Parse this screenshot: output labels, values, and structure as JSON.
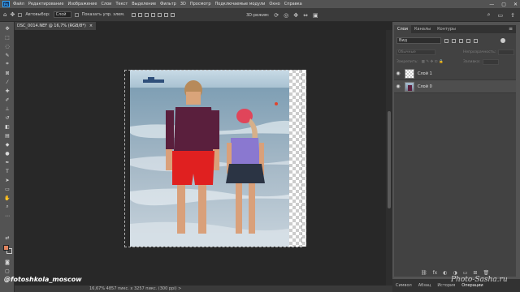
{
  "menu": {
    "logo": "Ps",
    "items": [
      "Файл",
      "Редактирование",
      "Изображение",
      "Слои",
      "Текст",
      "Выделение",
      "Фильтр",
      "3D",
      "Просмотр",
      "Подключаемые модули",
      "Окно",
      "Справка"
    ]
  },
  "window_controls": {
    "minimize": "—",
    "maximize": "▢",
    "close": "✕"
  },
  "options": {
    "autoselect_label": "Автовыбор:",
    "autoselect_value": "Слой",
    "show_controls_label": "Показать упр. элем.",
    "mode_3d_label": "3D-режим:"
  },
  "document": {
    "tab_title": "DSC_0014.NEF @ 16,7% (RGB/8*)",
    "tab_close": "×"
  },
  "status": {
    "text": "16,67%   4857 пикс. x 3257 пикс. (300 ppi)   >"
  },
  "watermarks": {
    "left": "@fotoshkola_moscow",
    "right": "Photo-Sasha.ru"
  },
  "panel": {
    "tabs": [
      "Слои",
      "Каналы",
      "Контуры"
    ],
    "active_tab": "Слои",
    "kind_select": "Вид",
    "blend_mode": "Обычные",
    "opacity_label": "Непрозрачность:",
    "lock_label": "Закрепить:",
    "fill_label": "Заливка:",
    "layers": [
      {
        "name": "Слой 1",
        "thumb": "checker",
        "active": false
      },
      {
        "name": "Слой 0",
        "thumb": "photo",
        "active": true
      }
    ]
  },
  "bottom_tabs": [
    "Символ",
    "Абзац",
    "История",
    "Операции"
  ],
  "colors": {
    "foreground": "#e0845f",
    "background": "#4a4a4a",
    "accent": "#31a8ff"
  }
}
